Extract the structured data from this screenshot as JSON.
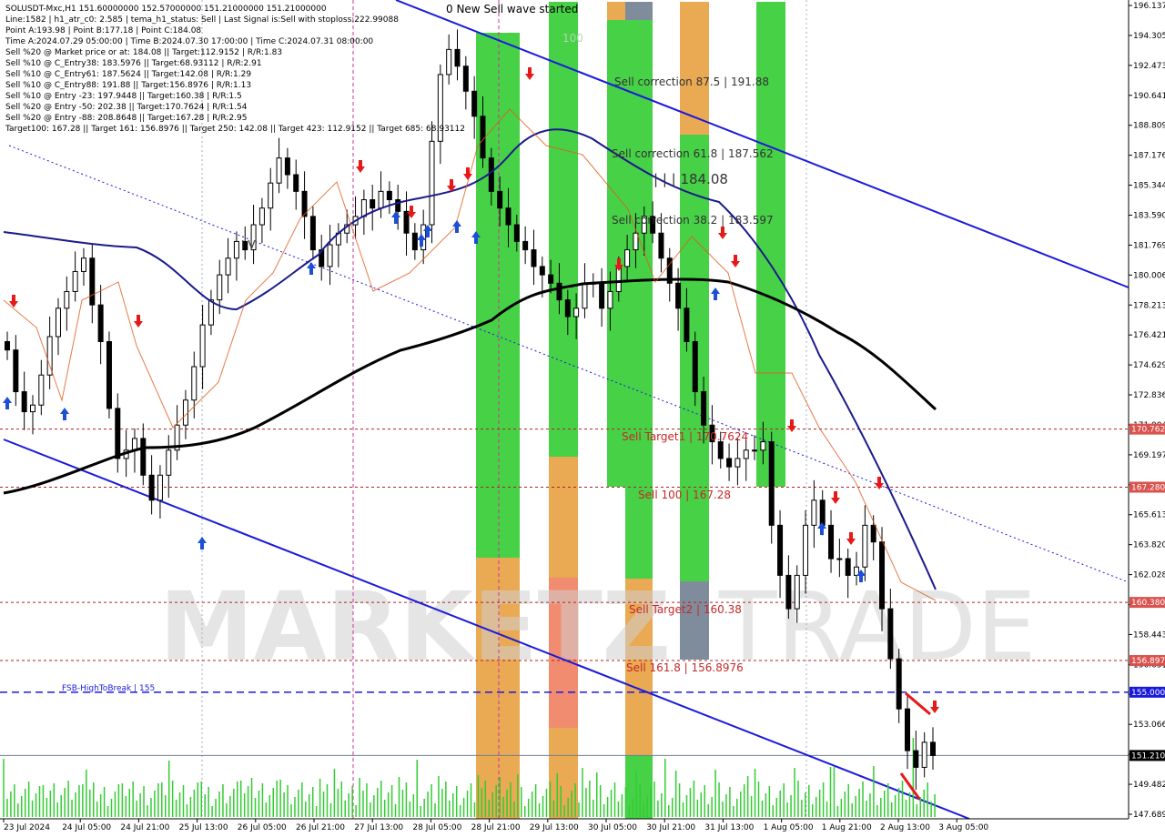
{
  "header": {
    "symbol_line": "SOLUSDT-Mxc,H1  151.60000000 152.57000000 151.21000000 151.21000000",
    "lines": [
      "Line:1582 | h1_atr_c0: 2.585 | tema_h1_status: Sell | Last Signal is:Sell with stoploss:222.99088",
      "Point A:193.98 | Point B:177.18 | Point C:184.08",
      "Time A:2024.07.29 05:00:00 | Time B:2024.07.30 17:00:00 | Time C:2024.07.31 08:00:00",
      "Sell %20 @ Market price or at: 184.08 || Target:112.9152 | R/R:1.83",
      "Sell %10 @ C_Entry38: 183.5976 || Target:68.93112 | R/R:2.91",
      "Sell %10 @ C_Entry61: 187.5624 || Target:142.08 | R/R:1.29",
      "Sell %10 @ C_Entry88: 191.88 || Target:156.8976 | R/R:1.13",
      "Sell %10 @ Entry -23: 197.9448 || Target:160.38 | R/R:1.5",
      "Sell %20 @ Entry -50: 202.38 || Target:170.7624 | R/R:1.54",
      "Sell %20 @ Entry -88: 208.8648 || Target:167.28 | R/R:2.95",
      "Target100: 167.28 || Target 161: 156.8976 || Target 250: 142.08 || Target 423: 112.9152 || Target 685: 68.93112"
    ]
  },
  "watermark": {
    "left": "MARKETZ",
    "right": "TRADE"
  },
  "chart_labels": {
    "new_sell_wave": "0 New Sell wave started",
    "level_100": "100",
    "sell_correction_875": "Sell correction 87.5 | 191.88",
    "sell_correction_618": "Sell correction 61.8 | 187.562",
    "sell_correction_382": "Sell correction 38.2 | 183.597",
    "point_c_label": "| | | 184.08",
    "iv_label": "I V",
    "sell_target1": "Sell Target1 | 170.7624",
    "sell_100": "Sell 100 | 167.28",
    "sell_target2": "Sell Target2 | 160.38",
    "sell_1618": "Sell 161.8 | 156.8976",
    "fsb_label": "FSB-HighToBreak | 155"
  },
  "price_axis": {
    "ticks": [
      "196.137",
      "194.305",
      "192.473",
      "190.641",
      "188.809",
      "187.176",
      "185.344",
      "183.590",
      "181.769",
      "180.006",
      "178.213",
      "176.421",
      "174.629",
      "172.836",
      "171.004",
      "169.197",
      "167.390",
      "165.613",
      "163.820",
      "162.028",
      "160.236",
      "158.443",
      "156.651",
      "154.859",
      "153.066",
      "151.274",
      "149.482",
      "147.689"
    ],
    "badges": [
      {
        "text": "170.762",
        "color": "#d9534f"
      },
      {
        "text": "167.280",
        "color": "#d9534f"
      },
      {
        "text": "160.380",
        "color": "#d9534f"
      },
      {
        "text": "156.897",
        "color": "#d9534f"
      },
      {
        "text": "155.000",
        "color": "#1a1adb"
      },
      {
        "text": "151.210",
        "color": "#000000"
      }
    ]
  },
  "time_axis": {
    "labels": [
      "23 Jul 2024",
      "24 Jul 05:00",
      "24 Jul 21:00",
      "25 Jul 13:00",
      "26 Jul 05:00",
      "26 Jul 21:00",
      "27 Jul 13:00",
      "28 Jul 05:00",
      "28 Jul 21:00",
      "29 Jul 13:00",
      "30 Jul 05:00",
      "30 Jul 21:00",
      "31 Jul 13:00",
      "1 Aug 05:00",
      "1 Aug 21:00",
      "2 Aug 13:00",
      "3 Aug 05:00"
    ]
  },
  "colors": {
    "green": "#33cc33",
    "orange": "#e8a040",
    "salmon": "#f08060",
    "gray": "#708090",
    "blue_channel": "#1a1adb",
    "target_red": "#b22222",
    "sell_arrow": "#e61919",
    "buy_arrow": "#1a4fd6"
  },
  "chart_data": {
    "type": "candlestick",
    "title": "SOLUSDT-Mxc,H1",
    "ylim": [
      147.689,
      196.137
    ],
    "ohlc_last": {
      "open": 151.6,
      "high": 152.57,
      "low": 151.21,
      "close": 151.21
    },
    "x_ticks": [
      "23 Jul 2024",
      "24 Jul 05:00",
      "24 Jul 21:00",
      "25 Jul 13:00",
      "26 Jul 05:00",
      "26 Jul 21:00",
      "27 Jul 13:00",
      "28 Jul 05:00",
      "28 Jul 21:00",
      "29 Jul 13:00",
      "30 Jul 05:00",
      "30 Jul 21:00",
      "31 Jul 13:00",
      "1 Aug 05:00",
      "1 Aug 21:00",
      "2 Aug 13:00",
      "3 Aug 05:00"
    ],
    "levels": [
      {
        "name": "Sell Target1",
        "value": 170.7624
      },
      {
        "name": "Sell 100",
        "value": 167.28
      },
      {
        "name": "Sell Target2",
        "value": 160.38
      },
      {
        "name": "Sell 161.8",
        "value": 156.8976
      },
      {
        "name": "FSB-HighToBreak",
        "value": 155
      },
      {
        "name": "Last",
        "value": 151.21
      }
    ],
    "closes": [
      175.5,
      173.0,
      171.8,
      172.2,
      174.0,
      176.3,
      178.0,
      179.0,
      180.2,
      181.0,
      178.2,
      176.0,
      172.0,
      169.0,
      169.5,
      170.2,
      168.0,
      166.5,
      168.0,
      169.5,
      171.0,
      172.5,
      174.5,
      177.0,
      178.5,
      180.0,
      181.0,
      182.0,
      181.5,
      183.0,
      184.0,
      185.5,
      187.0,
      186.0,
      185.0,
      183.5,
      181.5,
      180.5,
      181.8,
      182.5,
      183.0,
      183.5,
      184.5,
      184.0,
      185.0,
      184.5,
      183.8,
      182.5,
      181.5,
      183.0,
      188.0,
      192.0,
      193.5,
      192.5,
      191.0,
      189.5,
      187.0,
      185.0,
      184.0,
      183.0,
      182.0,
      181.5,
      180.5,
      180.0,
      179.5,
      178.5,
      177.5,
      178.0,
      179.5,
      179.5,
      178.0,
      179.0,
      180.5,
      181.5,
      182.5,
      183.5,
      182.5,
      181.0,
      179.5,
      178.0,
      176.0,
      173.0,
      171.0,
      170.0,
      169.0,
      168.5,
      169.0,
      169.5,
      169.5,
      170.0,
      165.0,
      162.0,
      160.0,
      162.0,
      165.0,
      166.5,
      165.0,
      163.0,
      163.0,
      162.0,
      162.5,
      165.0,
      164.0,
      160.0,
      157.0,
      154.0,
      151.5,
      150.5,
      152.0,
      151.21
    ],
    "volume_scale": "relative"
  }
}
